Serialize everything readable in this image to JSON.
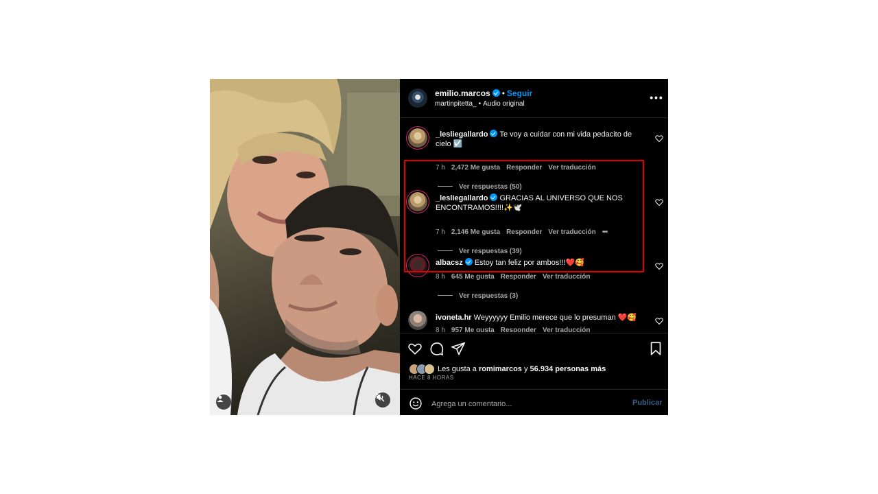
{
  "post": {
    "username": "emilio.marcos",
    "follow_label": "Seguir",
    "audio_user": "martinpitetta_",
    "audio_label": "Audio original"
  },
  "comments": [
    {
      "user": "_lesliegallardo",
      "text": "Te voy a cuidar con mi vida pedacito de cielo ☑️",
      "time": "7 h",
      "likes": "2,472 Me gusta",
      "reply": "Responder",
      "translate": "Ver traducción",
      "replies": "Ver respuestas (50)"
    },
    {
      "user": "_lesliegallardo",
      "text": "GRACIAS AL UNIVERSO QUE NOS ENCONTRAMOS!!!!✨🕊️",
      "time": "7 h",
      "likes": "2,146 Me gusta",
      "reply": "Responder",
      "translate": "Ver traducción",
      "replies": "Ver respuestas (39)"
    },
    {
      "user": "albacsz",
      "text": "Estoy tan feliz por ambos!!!❤️🥰",
      "time": "8 h",
      "likes": "645 Me gusta",
      "reply": "Responder",
      "translate": "Ver traducción",
      "replies": "Ver respuestas (3)"
    },
    {
      "user": "ivoneta.hr",
      "text": "Weyyyyyy Emilio merece que lo presuman ❤️🥰",
      "time": "8 h",
      "likes": "957 Me gusta",
      "reply": "Responder",
      "translate": "Ver traducción"
    }
  ],
  "likes": {
    "prefix": "Les gusta a",
    "user": "romimarcos",
    "connector": "y",
    "others": "56.934 personas más"
  },
  "time_ago": "HACE 8 HORAS",
  "add_comment": {
    "placeholder": "Agrega un comentario...",
    "publish_label": "Publicar"
  },
  "icons": [
    "heart-icon",
    "comment-icon",
    "share-icon",
    "bookmark-icon",
    "emoji-icon",
    "user-tag-icon",
    "muted-audio-icon",
    "more-options-icon",
    "verified-badge-icon"
  ],
  "colors": {
    "background": "#000000",
    "link_blue": "#0095f6",
    "highlight_red": "#e00000",
    "secondary_text": "#a8a8a8"
  }
}
